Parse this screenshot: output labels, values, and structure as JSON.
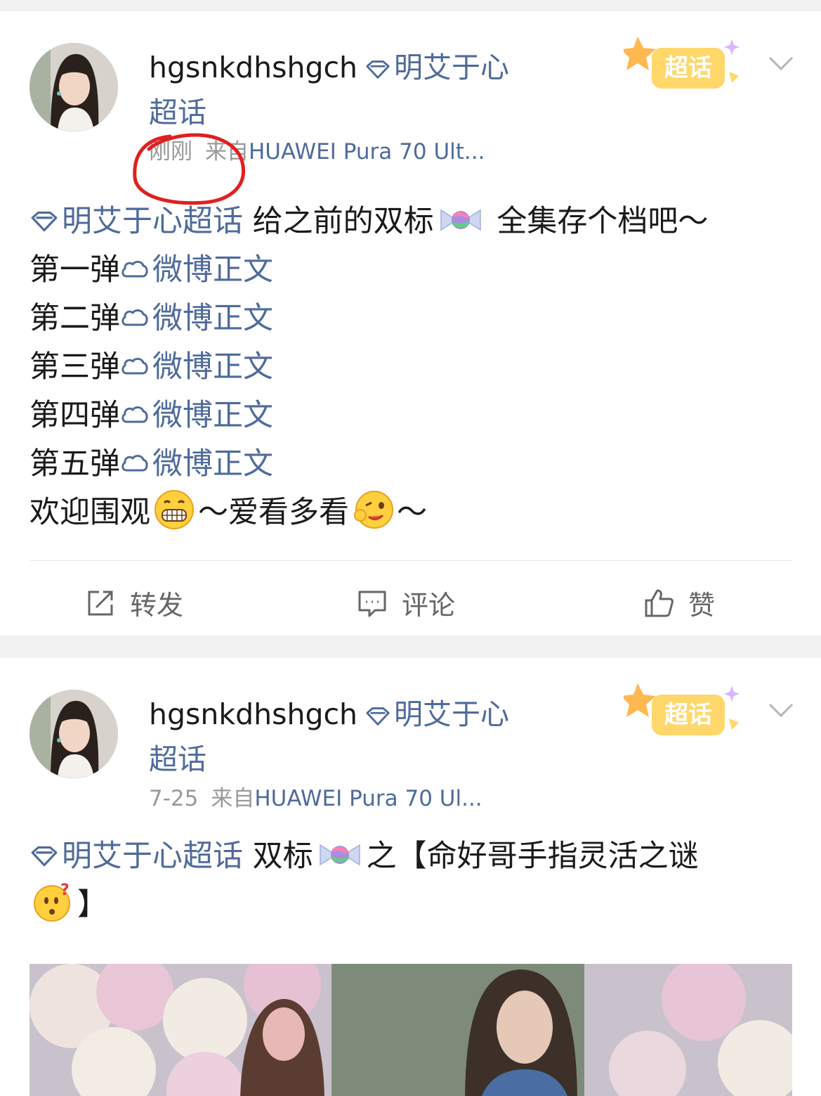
{
  "colors": {
    "topic_link": "#4f6b9b",
    "meta_gray": "#999999",
    "annotation_red": "#e02020",
    "badge_orange": "#f6b73c"
  },
  "posts": [
    {
      "username": "hgsnkdhshgch",
      "topic_line1": "明艾于心",
      "topic_line2": "超话",
      "time": "刚刚",
      "source_prefix": "来自",
      "device": "HUAWEI Pura 70 Ult...",
      "badge_label": "超话",
      "body": {
        "topic": "明艾于心超话",
        "intro_a": " 给之前的双标",
        "intro_b": " 全集存个档吧～",
        "items": [
          {
            "label": "第一弹",
            "link": "微博正文"
          },
          {
            "label": "第二弹",
            "link": "微博正文"
          },
          {
            "label": "第三弹",
            "link": "微博正文"
          },
          {
            "label": "第四弹",
            "link": "微博正文"
          },
          {
            "label": "第五弹",
            "link": "微博正文"
          }
        ],
        "closing_a": "欢迎围观",
        "closing_b": "～爱看多看",
        "closing_c": "～"
      },
      "actions": {
        "repost": "转发",
        "comment": "评论",
        "like": "赞"
      }
    },
    {
      "username": "hgsnkdhshgch",
      "topic_line1": "明艾于心",
      "topic_line2": "超话",
      "time": "7-25",
      "source_prefix": "来自",
      "device": "HUAWEI Pura 70 Ul...",
      "badge_label": "超话",
      "body": {
        "topic": "明艾于心超话",
        "text_a": " 双标",
        "text_b": "之【命好哥手指灵活之谜",
        "text_c": "】"
      }
    }
  ],
  "icons": {
    "super_topic_gem": "diamond-icon",
    "weibo_link": "cloud-link-icon",
    "repost": "repost-icon",
    "comment": "comment-icon",
    "like": "thumbs-up-icon",
    "menu": "chevron-down-icon"
  }
}
